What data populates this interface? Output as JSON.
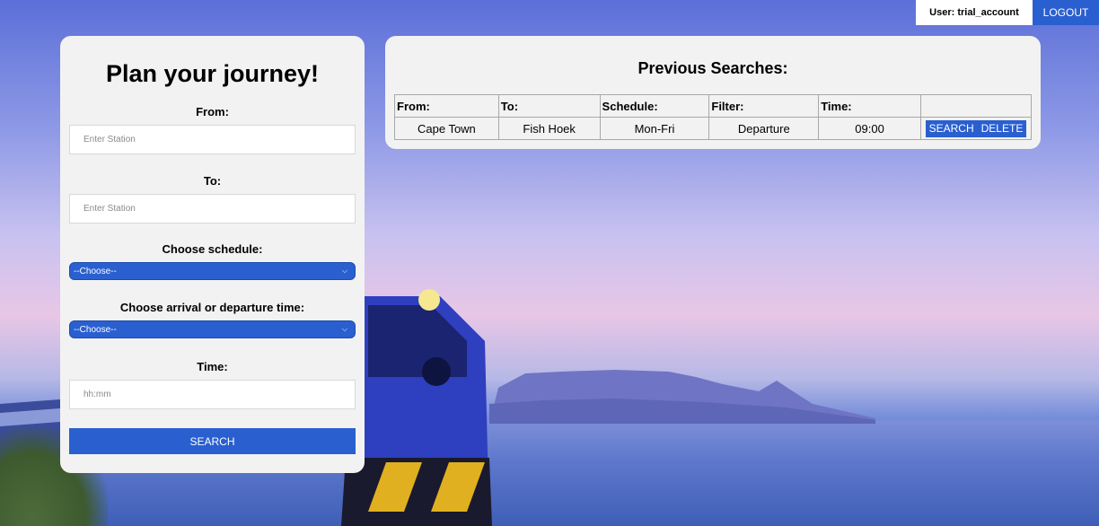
{
  "user": {
    "label": "User: trial_account",
    "logout_label": "LOGOUT"
  },
  "plan": {
    "title": "Plan your journey!",
    "from_label": "From:",
    "from_placeholder": "Enter Station",
    "to_label": "To:",
    "to_placeholder": "Enter Station",
    "schedule_label": "Choose schedule:",
    "schedule_value": "--Choose--",
    "arrdep_label": "Choose arrival or departure time:",
    "arrdep_value": "--Choose--",
    "time_label": "Time:",
    "time_placeholder": "hh:mm",
    "search_label": "SEARCH"
  },
  "previous": {
    "title": "Previous Searches:",
    "headers": [
      "From:",
      "To:",
      "Schedule:",
      "Filter:",
      "Time:",
      ""
    ],
    "rows": [
      {
        "from": "Cape Town",
        "to": "Fish Hoek",
        "schedule": "Mon-Fri",
        "filter": "Departure",
        "time": "09:00",
        "search_label": "SEARCH",
        "delete_label": "DELETE"
      }
    ]
  },
  "colors": {
    "accent": "#2a5fd0",
    "panel": "#f2f2f2"
  },
  "icons": {
    "select_chevron": "chevron-down-icon"
  }
}
